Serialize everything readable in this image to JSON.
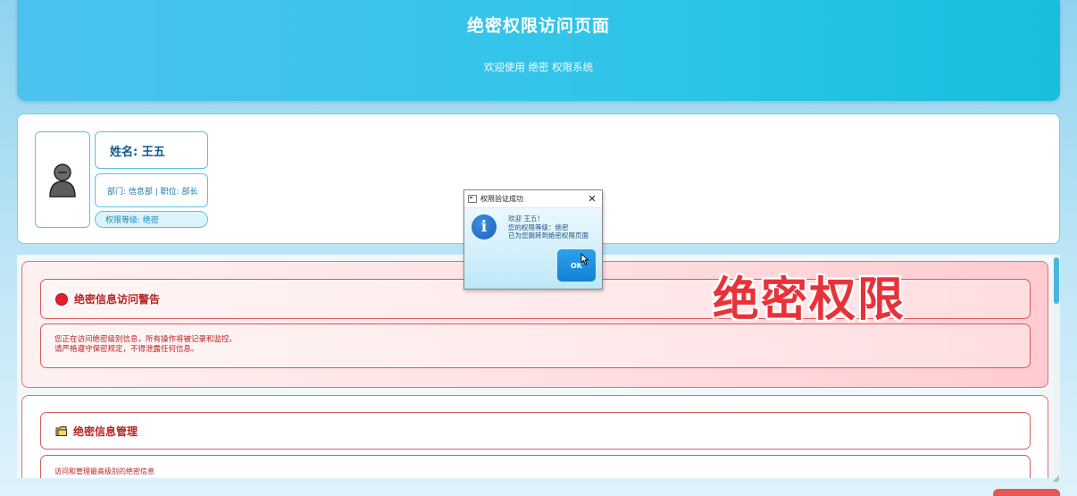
{
  "header": {
    "title": "绝密权限访问页面",
    "subtitle": "欢迎使用 绝密 权限系统"
  },
  "user": {
    "avatar_icon": "person-icon",
    "name": "姓名: 王五",
    "dept_position": "部门: 信息部 | 职位: 部长",
    "level": "权限等级: 绝密"
  },
  "warning": {
    "icon": "red-circle-icon",
    "title": "绝密信息访问警告",
    "body_line1": "您正在访问绝密级别信息，所有操作将被记录和监控。",
    "body_line2": "请严格遵守保密规定，不得泄露任何信息。"
  },
  "overlay": {
    "text": "绝密权限"
  },
  "management": {
    "icon": "folder-icon",
    "title": "绝密信息管理",
    "body": "访问和管理最高级别的绝密信息"
  },
  "dialog": {
    "title": "权限验证成功",
    "icon": "info-icon",
    "line1": "欢迎 王五！",
    "line2": "您的权限等级：绝密",
    "line3": "已为您跳转到绝密权限页面",
    "ok_label": "OK",
    "close_symbol": "✕"
  },
  "colors": {
    "header_start": "#4cc3ef",
    "header_end": "#16bfdc",
    "warning_red": "#b52525",
    "border_blue": "#5bc1e3"
  }
}
